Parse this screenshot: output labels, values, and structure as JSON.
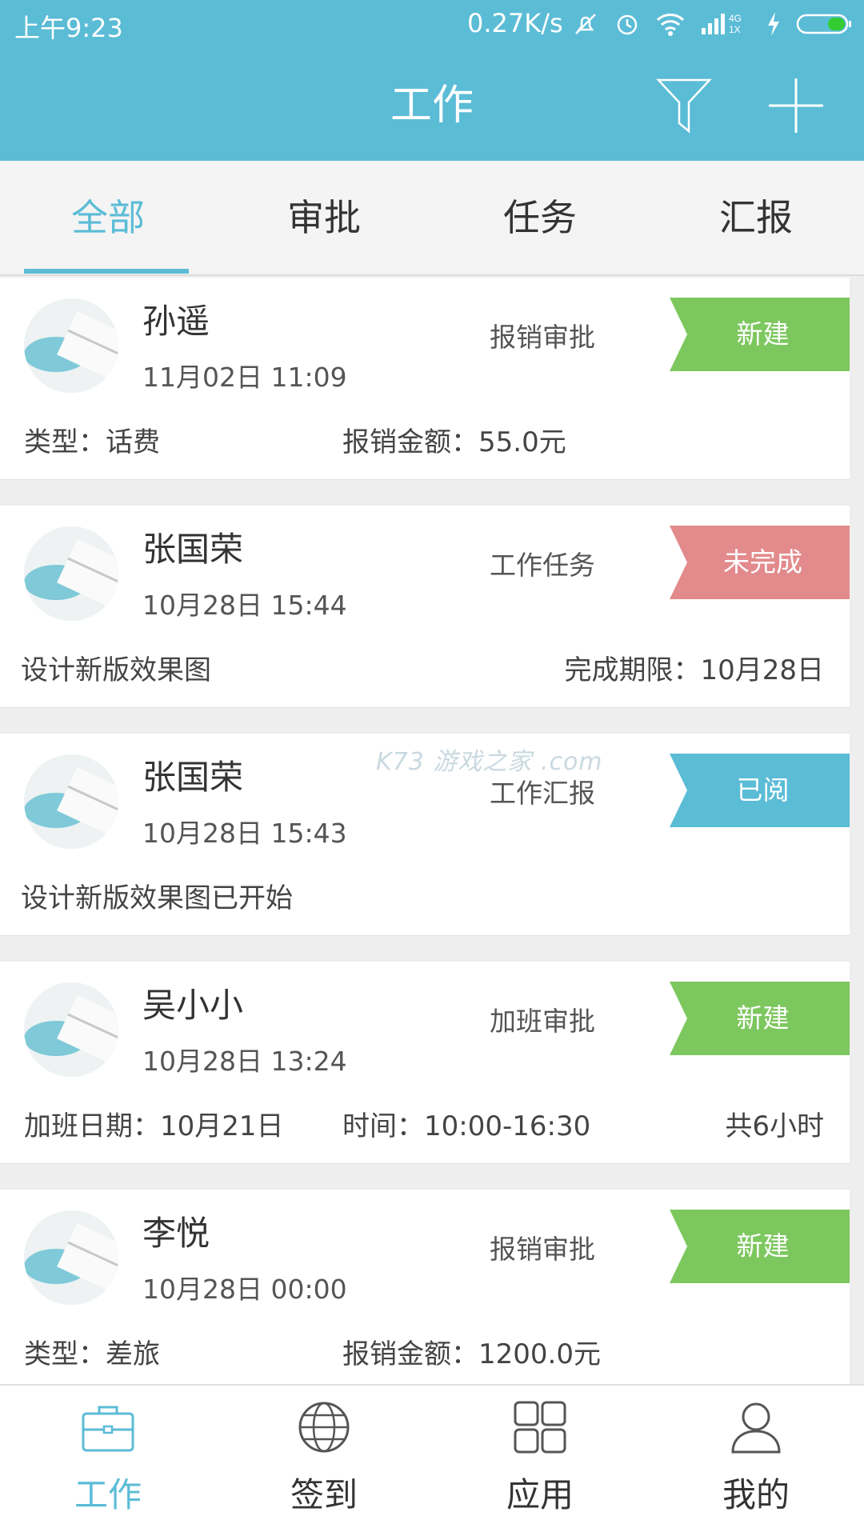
{
  "status_bar": {
    "time": "上午9:23",
    "speed": "0.27K/s",
    "icons": [
      "mute-icon",
      "alarm-icon",
      "wifi-icon",
      "signal-4g-icon",
      "charging-icon",
      "battery-icon"
    ]
  },
  "header": {
    "title": "工作",
    "filter_icon": "filter-icon",
    "add_icon": "plus-icon",
    "color": "#5bbcd6"
  },
  "tabs": [
    {
      "label": "全部",
      "active": true
    },
    {
      "label": "审批",
      "active": false
    },
    {
      "label": "任务",
      "active": false
    },
    {
      "label": "汇报",
      "active": false
    }
  ],
  "items": [
    {
      "name": "孙遥",
      "date": "11月02日 11:09",
      "type": "报销审批",
      "badge": "新建",
      "badge_color": "#7dc75f",
      "detail1": "类型：话费",
      "detail2": "报销金额：55.0元",
      "detail3": ""
    },
    {
      "name": "张国荣",
      "date": "10月28日 15:44",
      "type": "工作任务",
      "badge": "未完成",
      "badge_color": "#e28a8c",
      "detail1": "设计新版效果图",
      "detail2": "",
      "detail3": "完成期限：10月28日"
    },
    {
      "name": "张国荣",
      "date": "10月28日 15:43",
      "type": "工作汇报",
      "badge": "已阅",
      "badge_color": "#5bbcd6",
      "detail1": "设计新版效果图已开始",
      "detail2": "",
      "detail3": ""
    },
    {
      "name": "吴小小",
      "date": "10月28日 13:24",
      "type": "加班审批",
      "badge": "新建",
      "badge_color": "#7dc75f",
      "detail1": "加班日期：10月21日",
      "detail2": "时间：10:00-16:30",
      "detail3": "共6小时"
    },
    {
      "name": "李悦",
      "date": "10月28日 00:00",
      "type": "报销审批",
      "badge": "新建",
      "badge_color": "#7dc75f",
      "detail1": "类型：差旅",
      "detail2": "报销金额：1200.0元",
      "detail3": ""
    }
  ],
  "watermark": "K73 游戏之家 .com",
  "bottom_nav": [
    {
      "label": "工作",
      "icon": "briefcase-icon",
      "active": true
    },
    {
      "label": "签到",
      "icon": "globe-icon",
      "active": false
    },
    {
      "label": "应用",
      "icon": "apps-grid-icon",
      "active": false
    },
    {
      "label": "我的",
      "icon": "person-icon",
      "active": false
    }
  ]
}
